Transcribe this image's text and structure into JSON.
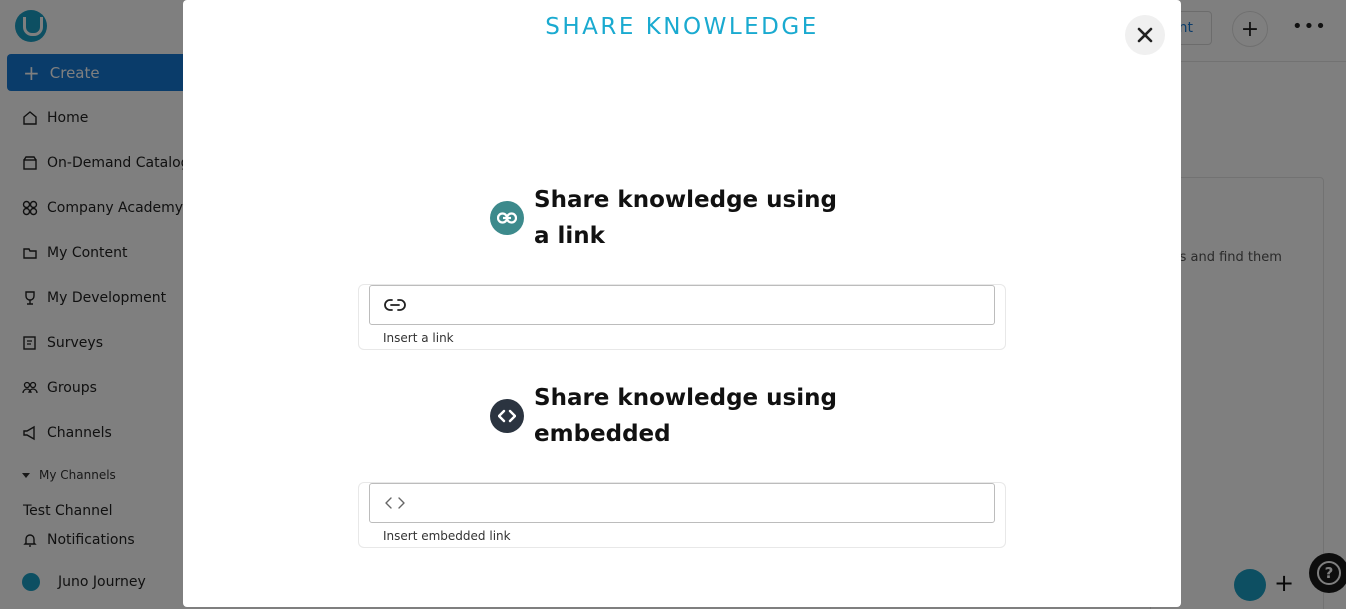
{
  "app": {
    "create_label": "Create",
    "nav": [
      {
        "label": "Home",
        "icon": "home-icon"
      },
      {
        "label": "On-Demand Catalog",
        "icon": "store-icon"
      },
      {
        "label": "Company Academy",
        "icon": "grid-icon"
      },
      {
        "label": "My Content",
        "icon": "folder-icon"
      },
      {
        "label": "My Development",
        "icon": "trophy-icon"
      },
      {
        "label": "Surveys",
        "icon": "survey-icon"
      },
      {
        "label": "Groups",
        "icon": "groups-icon"
      },
      {
        "label": "Channels",
        "icon": "megaphone-icon"
      }
    ],
    "my_channels_label": "My Channels",
    "channel_item": "Test Channel",
    "notifications_label": "Notifications",
    "user_label": "Juno Journey",
    "topbar_button_fragment": "nt",
    "background_text_fragment": "els and find them",
    "colors": {
      "accent": "#1aaad0",
      "brand": "#1a9fc4",
      "primary": "#1478d4",
      "link_icon_bg": "#3d8a8c",
      "embed_icon_bg": "#2b3440"
    }
  },
  "modal": {
    "title": "SHARE KNOWLEDGE",
    "link_section": {
      "title": "Share knowledge using a link",
      "icon": "link-icon",
      "input_icon": "link-outline-icon",
      "value": "",
      "caption": "Insert a link"
    },
    "embed_section": {
      "title": "Share knowledge using embedded",
      "icon": "code-icon",
      "input_icon": "code-outline-icon",
      "value": "",
      "caption": "Insert embedded link"
    }
  }
}
